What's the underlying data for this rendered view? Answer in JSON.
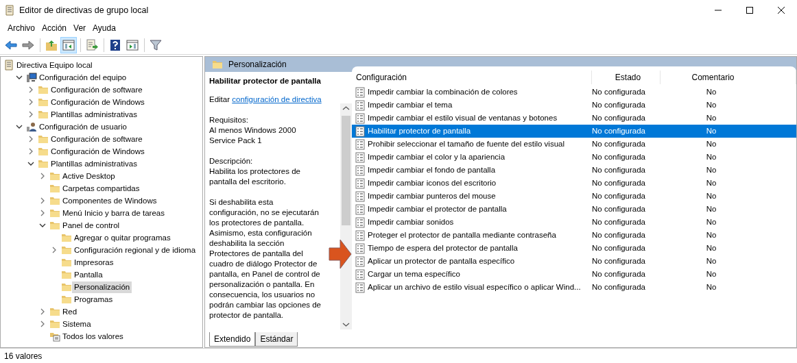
{
  "window": {
    "title": "Editor de directivas de grupo local"
  },
  "menu": [
    "Archivo",
    "Acción",
    "Ver",
    "Ayuda"
  ],
  "toolbar": [
    [
      {
        "kind": "back",
        "selected": false
      },
      {
        "kind": "forward",
        "selected": false
      }
    ],
    [
      {
        "kind": "up",
        "selected": false
      },
      {
        "kind": "tree",
        "selected": true
      }
    ],
    [
      {
        "kind": "export",
        "selected": false
      }
    ],
    [
      {
        "kind": "help",
        "selected": false
      },
      {
        "kind": "pane",
        "selected": false
      }
    ],
    [
      {
        "kind": "filter",
        "selected": false
      }
    ]
  ],
  "tree": [
    {
      "label": "Directiva Equipo local",
      "kind": "policy",
      "expandable": false,
      "selected": false,
      "children": [
        {
          "label": "Configuración del equipo",
          "kind": "computer",
          "expandable": true,
          "expanded": true,
          "selected": false,
          "children": [
            {
              "label": "Configuración de software",
              "kind": "folder",
              "expandable": true,
              "expanded": false,
              "selected": false
            },
            {
              "label": "Configuración de Windows",
              "kind": "folder",
              "expandable": true,
              "expanded": false,
              "selected": false
            },
            {
              "label": "Plantillas administrativas",
              "kind": "folder",
              "expandable": true,
              "expanded": false,
              "selected": false
            }
          ]
        },
        {
          "label": "Configuración de usuario",
          "kind": "user",
          "expandable": true,
          "expanded": true,
          "selected": false,
          "children": [
            {
              "label": "Configuración de software",
              "kind": "folder",
              "expandable": true,
              "expanded": false,
              "selected": false
            },
            {
              "label": "Configuración de Windows",
              "kind": "folder",
              "expandable": true,
              "expanded": false,
              "selected": false
            },
            {
              "label": "Plantillas administrativas",
              "kind": "folder",
              "expandable": true,
              "expanded": true,
              "selected": false,
              "children": [
                {
                  "label": "Active Desktop",
                  "kind": "folder",
                  "expandable": true,
                  "expanded": false,
                  "selected": false
                },
                {
                  "label": "Carpetas compartidas",
                  "kind": "folder",
                  "expandable": false,
                  "selected": false
                },
                {
                  "label": "Componentes de Windows",
                  "kind": "folder",
                  "expandable": true,
                  "expanded": false,
                  "selected": false
                },
                {
                  "label": "Menú Inicio y barra de tareas",
                  "kind": "folder",
                  "expandable": true,
                  "expanded": false,
                  "selected": false
                },
                {
                  "label": "Panel de control",
                  "kind": "folder",
                  "expandable": true,
                  "expanded": true,
                  "selected": false,
                  "children": [
                    {
                      "label": "Agregar o quitar programas",
                      "kind": "folder",
                      "expandable": false,
                      "selected": false
                    },
                    {
                      "label": "Configuración regional y de idioma",
                      "kind": "folder",
                      "expandable": true,
                      "expanded": false,
                      "selected": false
                    },
                    {
                      "label": "Impresoras",
                      "kind": "folder",
                      "expandable": false,
                      "selected": false
                    },
                    {
                      "label": "Pantalla",
                      "kind": "folder",
                      "expandable": false,
                      "selected": false
                    },
                    {
                      "label": "Personalización",
                      "kind": "folder",
                      "expandable": false,
                      "selected": true
                    },
                    {
                      "label": "Programas",
                      "kind": "folder",
                      "expandable": false,
                      "selected": false
                    }
                  ]
                },
                {
                  "label": "Red",
                  "kind": "folder",
                  "expandable": true,
                  "expanded": false,
                  "selected": false
                },
                {
                  "label": "Sistema",
                  "kind": "folder",
                  "expandable": true,
                  "expanded": false,
                  "selected": false
                },
                {
                  "label": "Todos los valores",
                  "kind": "all-settings",
                  "expandable": false,
                  "selected": false
                }
              ]
            }
          ]
        }
      ]
    }
  ],
  "pane_header": "Personalización",
  "description": {
    "title": "Habilitar protector de pantalla",
    "edit_prefix": "Editar",
    "edit_link": "configuración de directiva",
    "requirements_label": "Requisitos:",
    "requirements": "Al menos Windows 2000 Service Pack 1",
    "description_label": "Descripción:",
    "summary": "Habilita los protectores de pantalla del escritorio.",
    "details": "Si deshabilita esta configuración, no se ejecutarán los protectores de pantalla. Asimismo, esta configuración deshabilita la sección Protectores de pantalla del cuadro de diálogo Protector de pantalla, en Panel de control de personalización o pantalla. En consecuencia, los usuarios no podrán cambiar las opciones de protector de pantalla."
  },
  "view_tabs": [
    {
      "label": "Extendido",
      "selected": true
    },
    {
      "label": "Estándar",
      "selected": false
    }
  ],
  "table": {
    "columns": [
      "Configuración",
      "Estado",
      "Comentario"
    ],
    "rows": [
      {
        "name": "Impedir cambiar la combinación de colores",
        "state": "No configurada",
        "comment": "No",
        "selected": false
      },
      {
        "name": "Impedir cambiar el tema",
        "state": "No configurada",
        "comment": "No",
        "selected": false
      },
      {
        "name": "Impedir cambiar el estilo visual de ventanas y botones",
        "state": "No configurada",
        "comment": "No",
        "selected": false
      },
      {
        "name": "Habilitar protector de pantalla",
        "state": "No configurada",
        "comment": "No",
        "selected": true
      },
      {
        "name": "Prohibir seleccionar el tamaño de fuente del estilo visual",
        "state": "No configurada",
        "comment": "No",
        "selected": false
      },
      {
        "name": "Impedir cambiar el color y la apariencia",
        "state": "No configurada",
        "comment": "No",
        "selected": false
      },
      {
        "name": "Impedir cambiar el fondo de pantalla",
        "state": "No configurada",
        "comment": "No",
        "selected": false
      },
      {
        "name": "Impedir cambiar iconos del escritorio",
        "state": "No configurada",
        "comment": "No",
        "selected": false
      },
      {
        "name": "Impedir cambiar punteros del mouse",
        "state": "No configurada",
        "comment": "No",
        "selected": false
      },
      {
        "name": "Impedir cambiar el protector de pantalla",
        "state": "No configurada",
        "comment": "No",
        "selected": false
      },
      {
        "name": "Impedir cambiar sonidos",
        "state": "No configurada",
        "comment": "No",
        "selected": false
      },
      {
        "name": "Proteger el protector de pantalla mediante contraseña",
        "state": "No configurada",
        "comment": "No",
        "selected": false
      },
      {
        "name": "Tiempo de espera del protector de pantalla",
        "state": "No configurada",
        "comment": "No",
        "selected": false
      },
      {
        "name": "Aplicar un protector de pantalla específico",
        "state": "No configurada",
        "comment": "No",
        "selected": false
      },
      {
        "name": "Cargar un tema específico",
        "state": "No configurada",
        "comment": "No",
        "selected": false
      },
      {
        "name": "Aplicar un archivo de estilo visual específico o aplicar Wind...",
        "state": "No configurada",
        "comment": "No",
        "selected": false
      }
    ]
  },
  "status_bar": "16 valores"
}
